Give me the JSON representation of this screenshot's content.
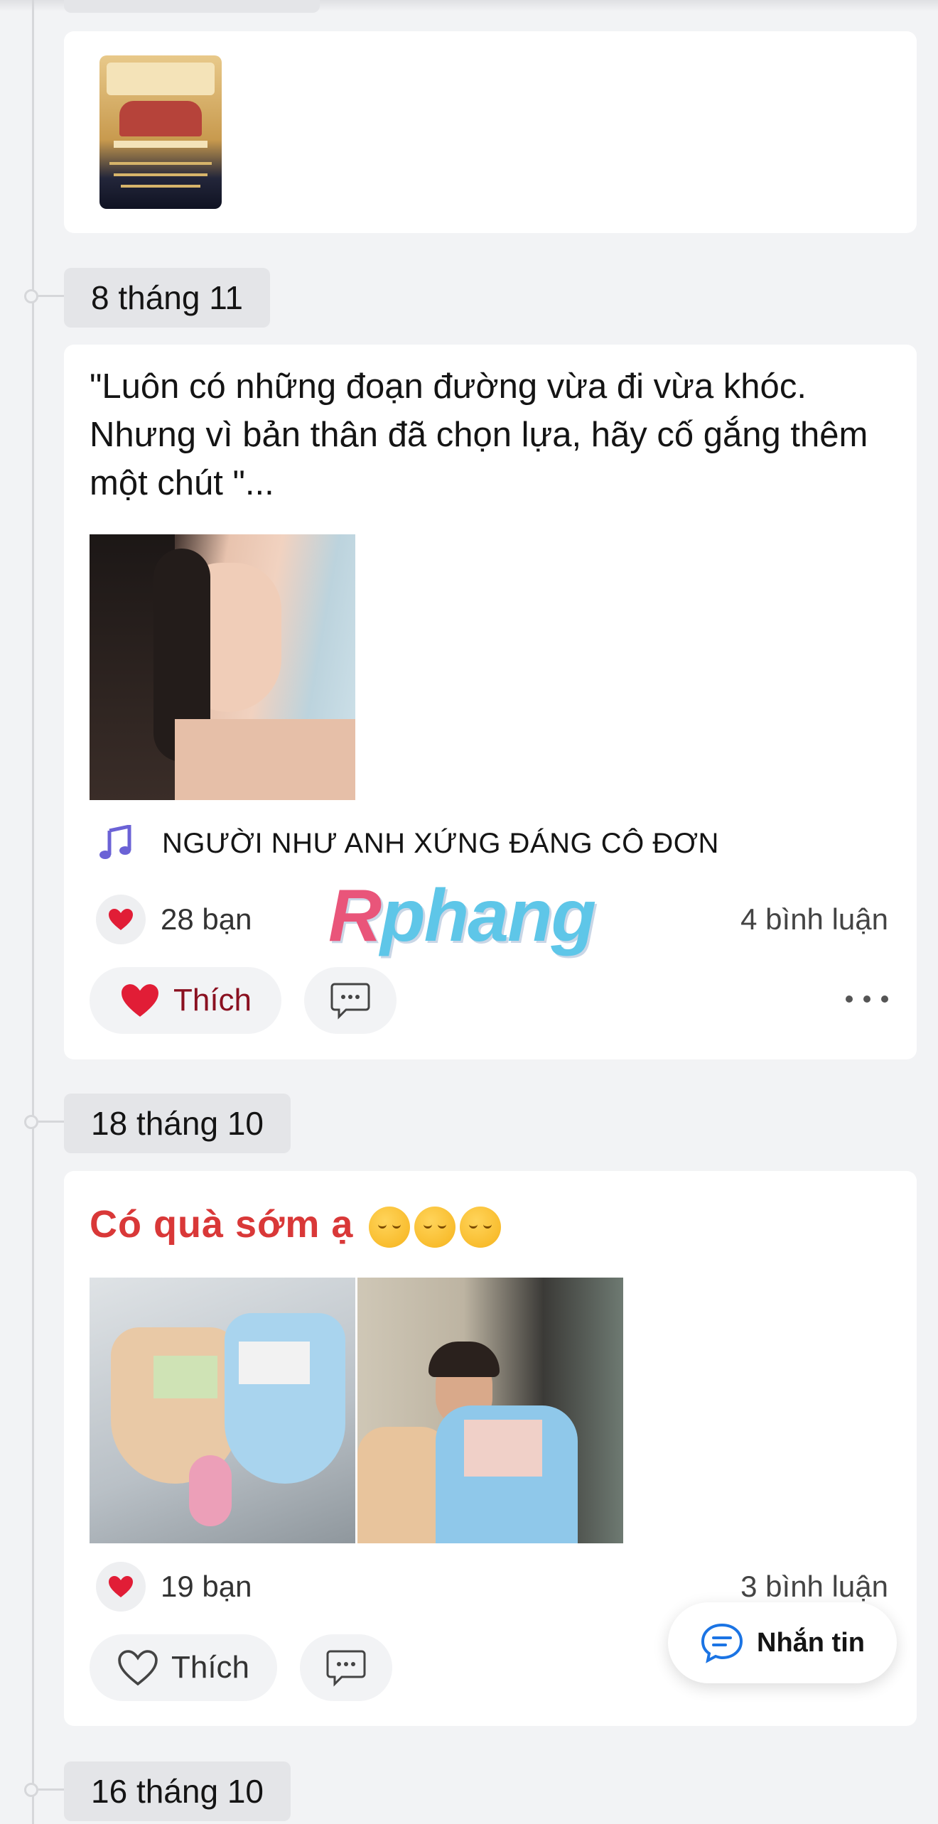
{
  "timeline": [
    {
      "date": "8 tháng 11"
    },
    {
      "date": "18 tháng 10"
    },
    {
      "date": "16 tháng 10"
    }
  ],
  "post_top": {
    "thumbnail_icon": "teachers-day-poster-image",
    "thumbnail_text": {
      "header": "CHÚC MỪNG\nNGÀY NHÀ GIÁO VIỆT NAM\n20/11",
      "subheader": "TRI ÂN CÁC THẦY CÔ"
    }
  },
  "post_1": {
    "text": "\"Luôn có những đoạn đường vừa đi vừa khóc. Nhưng vì bản thân đã chọn lựa, hãy cố gắng thêm một chút \"...",
    "music_icon": "music-note-icon",
    "music_title": "NGƯỜI NHƯ ANH XỨNG ĐÁNG CÔ ĐƠN",
    "reactions": "28 bạn",
    "comments": "4 bình luận",
    "like_label": "Thích",
    "like_state": "liked"
  },
  "watermark": {
    "part1": "R",
    "part2": "phang"
  },
  "post_2": {
    "title": "Có quà sớm ạ",
    "title_emojis": 3,
    "reactions": "19 bạn",
    "comments": "3 bình luận",
    "like_label": "Thích",
    "like_state": "not-liked"
  },
  "fab": {
    "label": "Nhắn tin",
    "icon": "chat-bubble-icon"
  },
  "colors": {
    "accent_red": "#d93838",
    "heart": "#e11d36",
    "messenger_blue": "#1b74e4"
  }
}
